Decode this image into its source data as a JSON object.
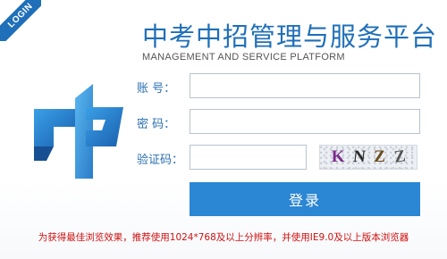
{
  "badge": {
    "label": "LOGIN"
  },
  "header": {
    "title_cn": "中考中招管理与服务平台",
    "title_en": "MANAGEMENT AND SERVICE PLATFORM"
  },
  "form": {
    "account_label": "账  号：",
    "password_label": "密  码：",
    "captcha_label": "验证码：",
    "account_value": "",
    "password_value": "",
    "captcha_value": "",
    "captcha_chars": [
      "K",
      "N",
      "Z",
      "Z"
    ],
    "login_button": "登录"
  },
  "notice": "为获得最佳浏览效果，推荐使用1024*768及以上分辨率，并使用IE9.0及以上版本浏览器",
  "colors": {
    "brand_blue": "#1f6fb9",
    "button_blue": "#2b86d4",
    "notice_red": "#d01010"
  },
  "icons": {
    "logo": "zhong-logo-icon"
  }
}
